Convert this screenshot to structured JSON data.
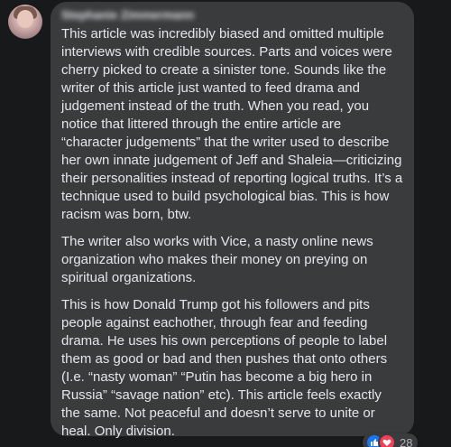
{
  "comment": {
    "author": "Stephanie Zimmermann",
    "paragraphs": [
      "This article was incredibly biased and omitted multiple interviews with credible sources. Parts and voices were cherry picked to create a sinister tone. Sounds like the writer of this article just wanted to feed drama and judgement instead of the truth. When you read, you notice that littered through the entire article are “character judgements” that the writer used to describe her own innate judgement of Jeff and Shaleia—criticizing their personalities instead of reporting logical truths. It’s a technique used to build psychological bias. This is how racism was born, btw.",
      "The writer also works with Vice, a nasty online news organization who makes their money on preying on spiritual organizations.",
      "This is how Donald Trump got his followers and pits people against eachother, through fear and feeding drama. He uses his own perceptions of people to label them as good or bad and then pushes that onto others (I.e. “nasty woman” “Putin has become a big hero in Russia” “savage nation” etc). This article feels exactly the same. Not peaceful and doesn’t serve to unite or heal. Only division."
    ]
  },
  "reactions": {
    "icons": [
      "like-icon",
      "love-icon"
    ],
    "count": "28"
  },
  "colors": {
    "background": "#18191a",
    "bubble": "#3a3b3c",
    "text": "#e4e6eb",
    "like": "#1877f2",
    "love": "#f33e58"
  }
}
